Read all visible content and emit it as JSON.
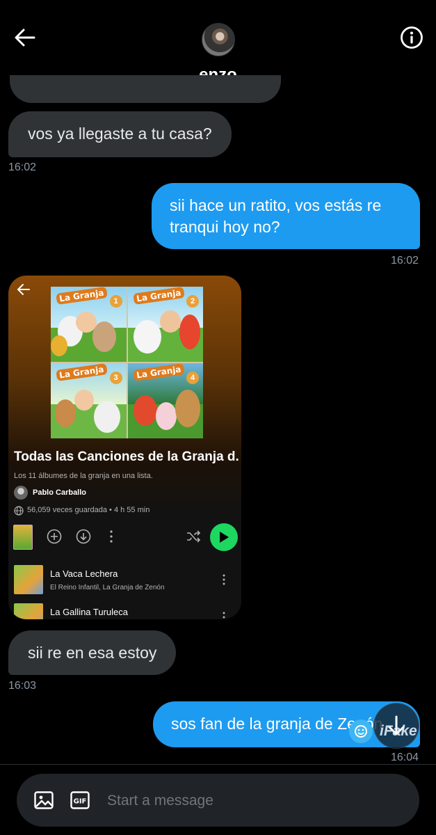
{
  "header": {
    "contact_name": "enzo"
  },
  "messages": [
    {
      "text": "vos ya llegaste a tu casa?",
      "time": "16:02"
    },
    {
      "text": "sii hace un ratito, vos estás re tranqui hoy no?",
      "time": "16:02"
    },
    {
      "text": "sii re en esa estoy",
      "time": "16:03"
    },
    {
      "text": "sos fan de la granja de Zenón",
      "time": "16:04"
    }
  ],
  "shared_playlist": {
    "title": "Todas las Canciones de la Granja d...",
    "description": "Los 11 álbumes de la granja en una lista.",
    "creator": "Pablo Carballo",
    "stats": "56,059 veces guardada • 4 h 55 min",
    "cover_logo": "La Granja",
    "cover_numbers": [
      "1",
      "2",
      "3",
      "4"
    ],
    "tracks": [
      {
        "title": "La Vaca Lechera",
        "artist": "El Reino Infantil, La Granja de Zenón"
      },
      {
        "title": "La Gallina Turuleca",
        "artist": ""
      }
    ],
    "colors": {
      "play": "#1ed760",
      "header_gradient": "#8a4a08"
    }
  },
  "composer": {
    "placeholder": "Start a message",
    "gif_label": "GIF"
  },
  "watermark": {
    "text": "iFake"
  },
  "colors": {
    "outgoing_bubble": "#1d9bf0",
    "incoming_bubble": "#2f3336",
    "background": "#000000"
  }
}
